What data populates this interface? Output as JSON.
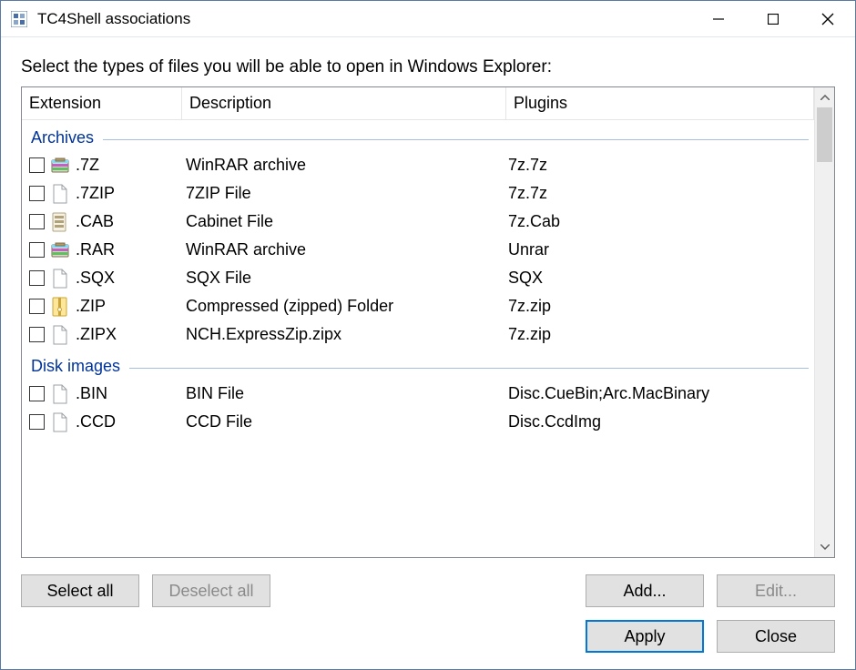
{
  "window": {
    "title": "TC4Shell associations"
  },
  "instruction": "Select the types of files you will be able to open in Windows Explorer:",
  "columns": {
    "extension": "Extension",
    "description": "Description",
    "plugins": "Plugins"
  },
  "groups": [
    {
      "name": "Archives",
      "items": [
        {
          "ext": ".7Z",
          "desc": "WinRAR archive",
          "plug": "7z.7z",
          "icon": "winrar"
        },
        {
          "ext": ".7ZIP",
          "desc": "7ZIP File",
          "plug": "7z.7z",
          "icon": "blank"
        },
        {
          "ext": ".CAB",
          "desc": "Cabinet File",
          "plug": "7z.Cab",
          "icon": "cab"
        },
        {
          "ext": ".RAR",
          "desc": "WinRAR archive",
          "plug": "Unrar",
          "icon": "winrar"
        },
        {
          "ext": ".SQX",
          "desc": "SQX File",
          "plug": "SQX",
          "icon": "blank"
        },
        {
          "ext": ".ZIP",
          "desc": "Compressed (zipped) Folder",
          "plug": "7z.zip",
          "icon": "zip"
        },
        {
          "ext": ".ZIPX",
          "desc": "NCH.ExpressZip.zipx",
          "plug": "7z.zip",
          "icon": "blank"
        }
      ]
    },
    {
      "name": "Disk images",
      "items": [
        {
          "ext": ".BIN",
          "desc": "BIN File",
          "plug": "Disc.CueBin;Arc.MacBinary",
          "icon": "blank"
        },
        {
          "ext": ".CCD",
          "desc": "CCD File",
          "plug": "Disc.CcdImg",
          "icon": "blank"
        }
      ]
    }
  ],
  "buttons": {
    "select_all": "Select all",
    "deselect_all": "Deselect all",
    "add": "Add...",
    "edit": "Edit...",
    "apply": "Apply",
    "close": "Close"
  }
}
